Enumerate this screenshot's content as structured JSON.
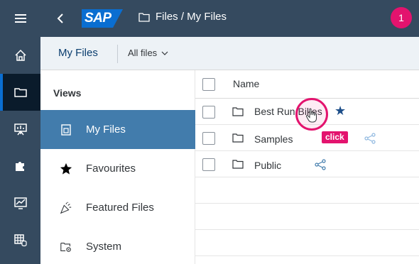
{
  "rail": {
    "items": [
      {
        "name": "menu-icon",
        "active": false
      },
      {
        "name": "home-icon",
        "active": false
      },
      {
        "name": "folder-icon",
        "active": true
      },
      {
        "name": "presentation-icon",
        "active": false
      },
      {
        "name": "puzzle-icon",
        "active": false
      },
      {
        "name": "analytics-icon",
        "active": false
      },
      {
        "name": "table-database-icon",
        "active": false
      }
    ]
  },
  "header": {
    "logo_text": "SAP",
    "breadcrumb": "Files / My Files",
    "notification_count": "1"
  },
  "subheader": {
    "tab_my_files": "My Files",
    "filter_label": "All files"
  },
  "views": {
    "title": "Views",
    "items": [
      {
        "label": "My Files",
        "icon": "document-icon",
        "selected": true
      },
      {
        "label": "Favourites",
        "icon": "star-icon",
        "selected": false
      },
      {
        "label": "Featured Files",
        "icon": "party-popper-icon",
        "selected": false
      },
      {
        "label": "System",
        "icon": "system-folder-icon",
        "selected": false
      }
    ]
  },
  "table": {
    "header_name": "Name",
    "rows": [
      {
        "name": "Best Run Bikes",
        "favourite": true,
        "shared": false
      },
      {
        "name": "Samples",
        "favourite": false,
        "shared": true
      },
      {
        "name": "Public",
        "favourite": false,
        "shared": true
      }
    ]
  },
  "overlay": {
    "click_label": "click"
  },
  "colors": {
    "shell": "#354a5f",
    "accent": "#0a6ed1",
    "selected_view": "#427cac",
    "highlight": "#e3136e"
  }
}
